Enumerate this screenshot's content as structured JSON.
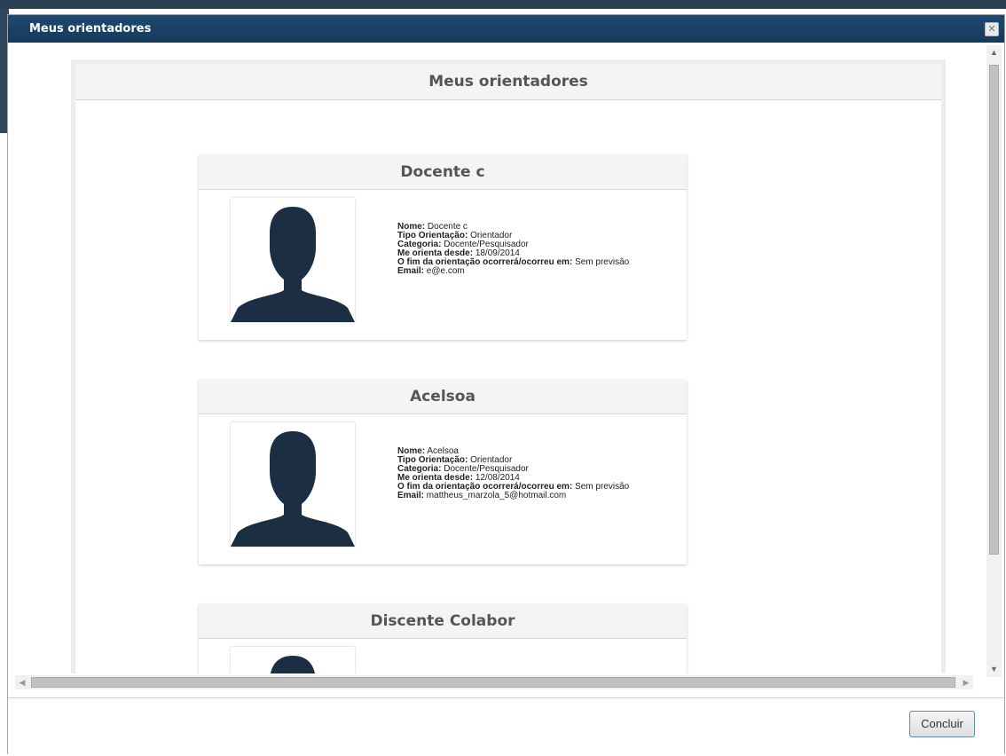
{
  "dialog": {
    "title": "Meus orientadores",
    "close_symbol": "✕"
  },
  "panel": {
    "title": "Meus orientadores"
  },
  "advisors": [
    {
      "name": "Docente c",
      "photo_icon": "user-silhouette-icon",
      "fields": [
        {
          "label": "Nome:",
          "value": "Docente c"
        },
        {
          "label": "Tipo Orientação:",
          "value": "Orientador"
        },
        {
          "label": "Categoria:",
          "value": "Docente/Pesquisador"
        },
        {
          "label": "Me orienta desde:",
          "value": "18/09/2014"
        },
        {
          "label": "O fim da orientação ocorrerá/ocorreu em:",
          "value": "Sem previsão"
        },
        {
          "label": "Email:",
          "value": "e@e.com"
        }
      ]
    },
    {
      "name": "Acelsoa",
      "photo_icon": "user-silhouette-icon",
      "fields": [
        {
          "label": "Nome:",
          "value": "Acelsoa"
        },
        {
          "label": "Tipo Orientação:",
          "value": "Orientador"
        },
        {
          "label": "Categoria:",
          "value": "Docente/Pesquisador"
        },
        {
          "label": "Me orienta desde:",
          "value": "12/08/2014"
        },
        {
          "label": "O fim da orientação ocorrerá/ocorreu em:",
          "value": "Sem previsão"
        },
        {
          "label": "Email:",
          "value": "mattheus_marzola_5@hotmail.com"
        }
      ]
    },
    {
      "name": "Discente Colabor",
      "photo_icon": "user-silhouette-icon",
      "fields": []
    }
  ],
  "footer": {
    "confirm_label": "Concluir"
  },
  "colors": {
    "titlebar": "#1a426a",
    "silhouette": "#1b2e42",
    "header_bg": "#f4f4f4",
    "button_border": "#5f8db4"
  }
}
